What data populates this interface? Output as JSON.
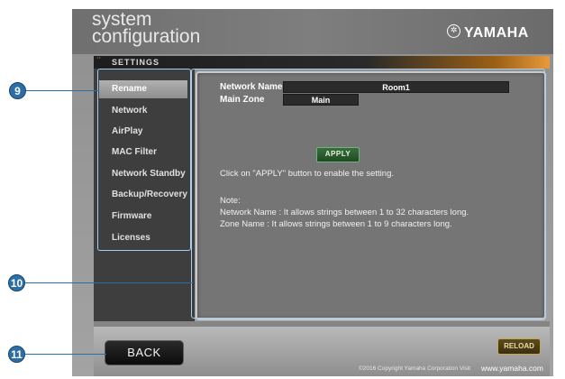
{
  "header": {
    "title_line1": "system",
    "title_line2": "configuration",
    "brand_mark": "✲",
    "brand": "YAMAHA"
  },
  "settings_label": "SETTINGS",
  "sidebar": {
    "items": [
      {
        "label": "Rename",
        "active": true
      },
      {
        "label": "Network",
        "active": false
      },
      {
        "label": "AirPlay",
        "active": false
      },
      {
        "label": "MAC Filter",
        "active": false
      },
      {
        "label": "Network Standby",
        "active": false
      },
      {
        "label": "Backup/Recovery",
        "active": false
      },
      {
        "label": "Firmware",
        "active": false
      },
      {
        "label": "Licenses",
        "active": false
      }
    ]
  },
  "form": {
    "network_name_label": "Network Name",
    "network_name_value": "Room1",
    "main_zone_label": "Main Zone",
    "main_zone_value": "Main",
    "apply_label": "APPLY"
  },
  "instructions": {
    "hint": "Click on \"APPLY\" button to enable the setting.",
    "note_title": "Note:",
    "note_1": "Network Name : It allows strings between 1 to 32 characters long.",
    "note_2": "Zone Name : It allows strings between 1 to 9 characters long."
  },
  "footer": {
    "back_label": "BACK",
    "reload_label": "RELOAD",
    "copyright": "©2016 Copyright Yamaha Corporation Visit",
    "site": "www.yamaha.com"
  },
  "callouts": {
    "c9": "9",
    "c10": "10",
    "c11": "11"
  },
  "colors": {
    "callout": "#2c6ea6",
    "selection": "#a9cdf0",
    "accent_orange": "#e79a3a",
    "apply_green": "#3a6e3e",
    "reload_gold": "#c9a64a"
  }
}
